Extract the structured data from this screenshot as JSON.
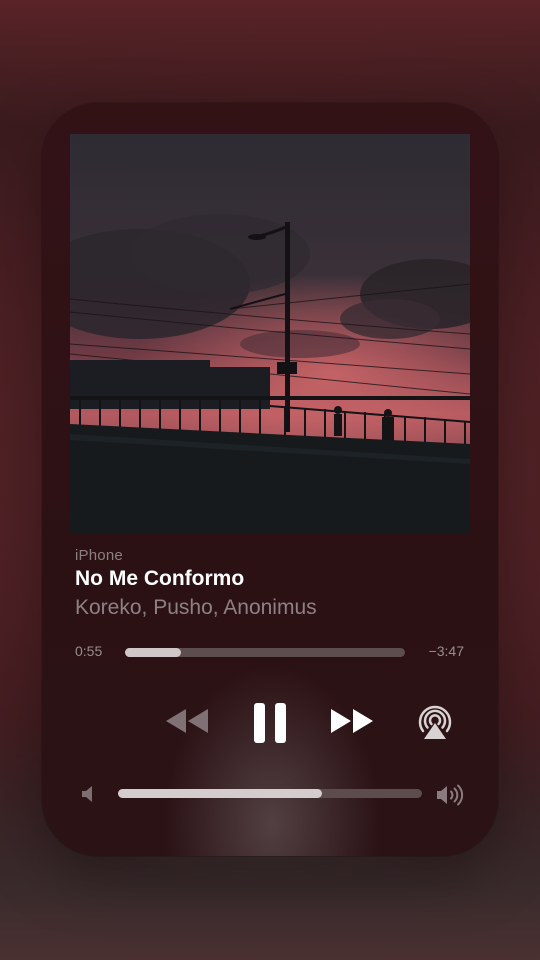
{
  "player": {
    "source": "iPhone",
    "track_title": "No Me Conformo",
    "artists": "Koreko, Pusho, Anonimus",
    "elapsed": "0:55",
    "remaining": "−3:47",
    "progress_fraction": 0.2,
    "volume_fraction": 0.67,
    "is_playing": true
  },
  "icons": {
    "rewind": "rewind-icon",
    "pause": "pause-icon",
    "forward": "fast-forward-icon",
    "airplay": "airplay-icon",
    "volume_low": "speaker-low-icon",
    "volume_high": "speaker-high-icon"
  },
  "colors": {
    "background": "#4d2024",
    "card": "#2f1114",
    "primary_text": "#ffffff",
    "secondary_text": "#8e8183"
  }
}
